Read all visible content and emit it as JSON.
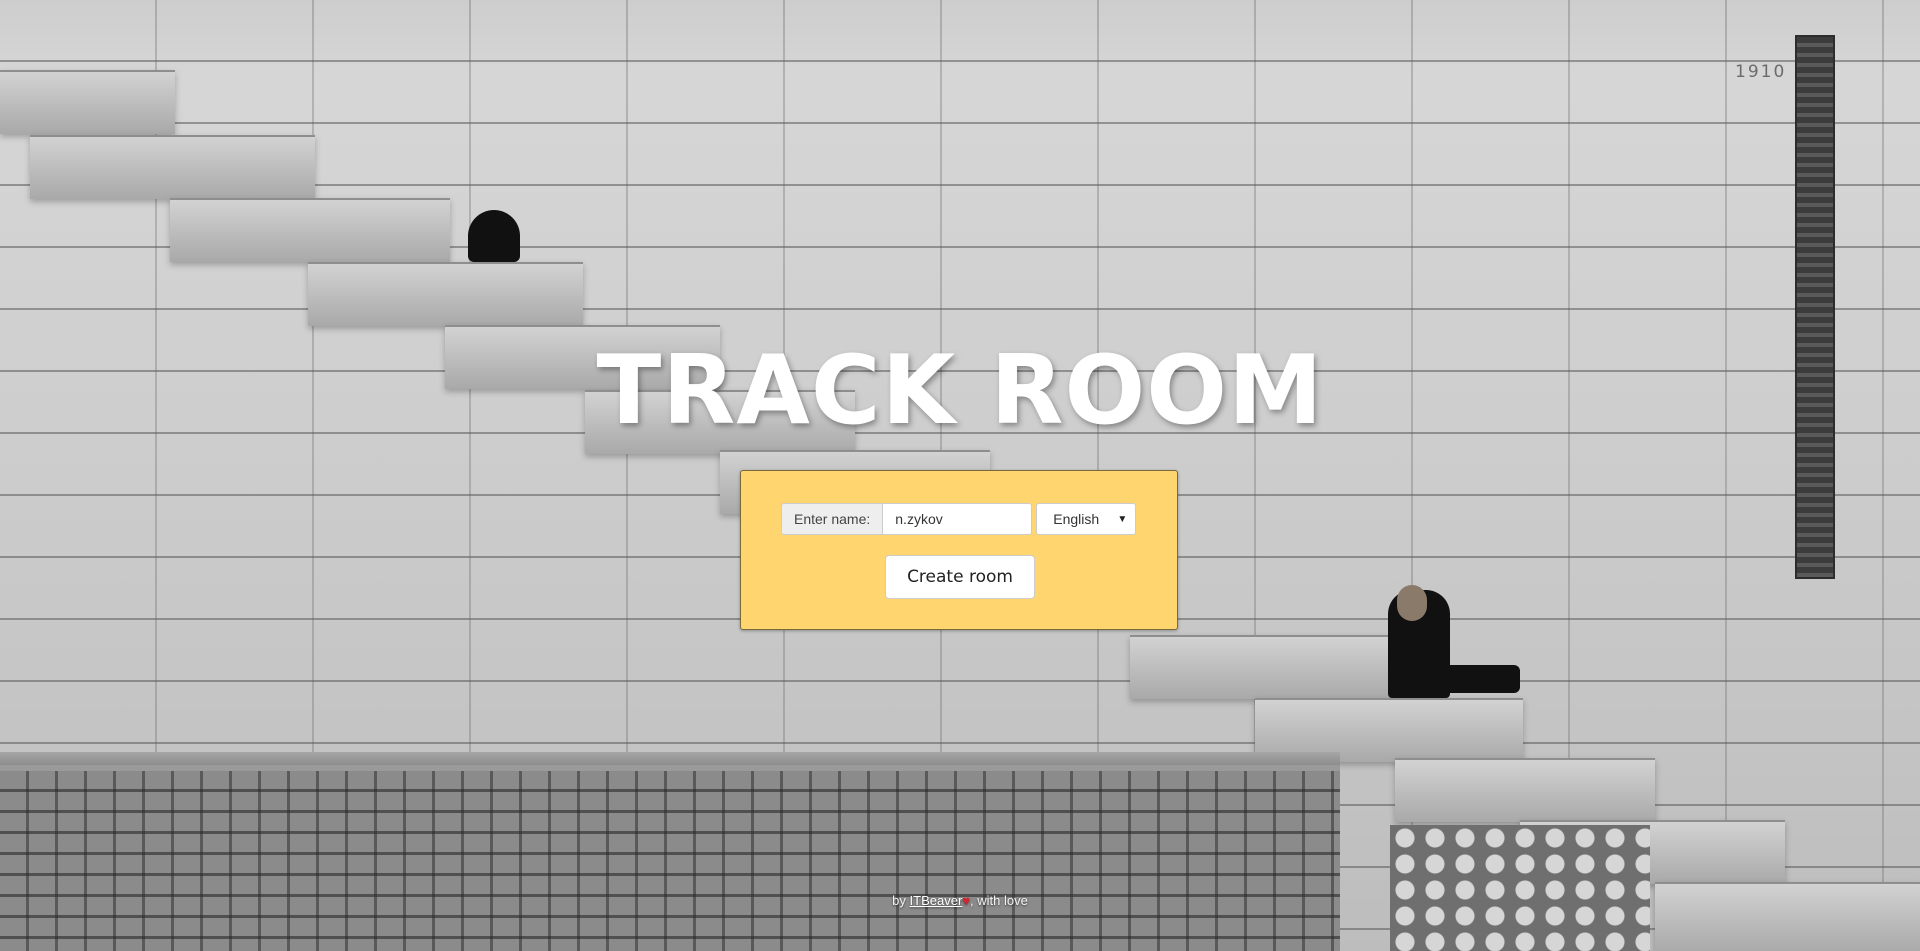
{
  "hero": {
    "title": "TRACK ROOM",
    "background_subject": "stone-staircase-photo",
    "engraved_year": "1910"
  },
  "form": {
    "panel_color": "#ffd570",
    "name_label": "Enter name:",
    "name_value": "n.zykov",
    "language_selected": "English",
    "create_button_label": "Create room"
  },
  "footer": {
    "prefix": "by",
    "link_text": "ITBeaver",
    "heart_icon": "heart-icon",
    "heart_glyph": "♥",
    "suffix": ", with love",
    "heart_color": "#d9232a"
  }
}
